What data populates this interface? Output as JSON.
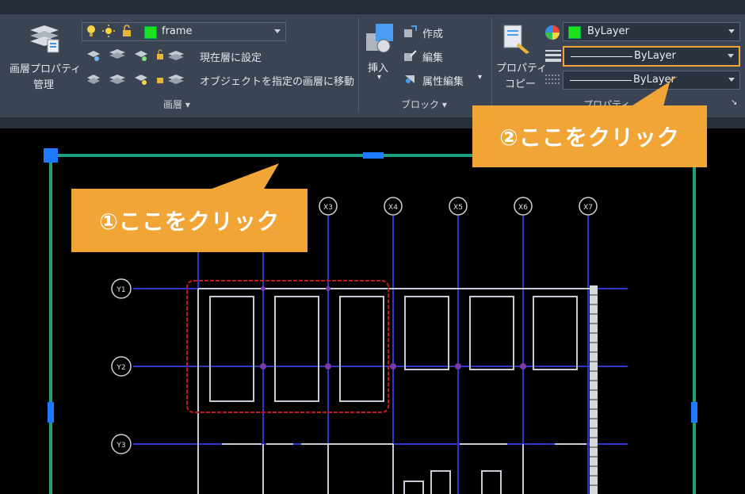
{
  "ribbon": {
    "layer_panel": {
      "large_button_line1": "画層プロパティ",
      "large_button_line2": "管理",
      "layer_combo_value": "frame",
      "set_current": "現在層に設定",
      "move_to_layer": "オブジェクトを指定の画層に移動",
      "title": "画層"
    },
    "block_panel": {
      "insert": "挿入",
      "create": "作成",
      "edit": "編集",
      "attr_edit": "属性編集",
      "title": "ブロック"
    },
    "properties_panel": {
      "copy_line1": "プロパティ",
      "copy_line2": "コピー",
      "color_value": "ByLayer",
      "lineweight_value": "ByLayer",
      "linetype_value": "ByLayer",
      "title": "プロパティ"
    },
    "colors": {
      "accent_green": "#1ee11e",
      "highlight": "#f0a536"
    }
  },
  "callouts": {
    "first": "①ここをクリック",
    "second": "②ここをクリック"
  },
  "drawing": {
    "column_labels": [
      "X3",
      "X4",
      "X5",
      "X6",
      "X7"
    ],
    "row_labels": [
      "Y1",
      "Y2",
      "Y3"
    ]
  }
}
